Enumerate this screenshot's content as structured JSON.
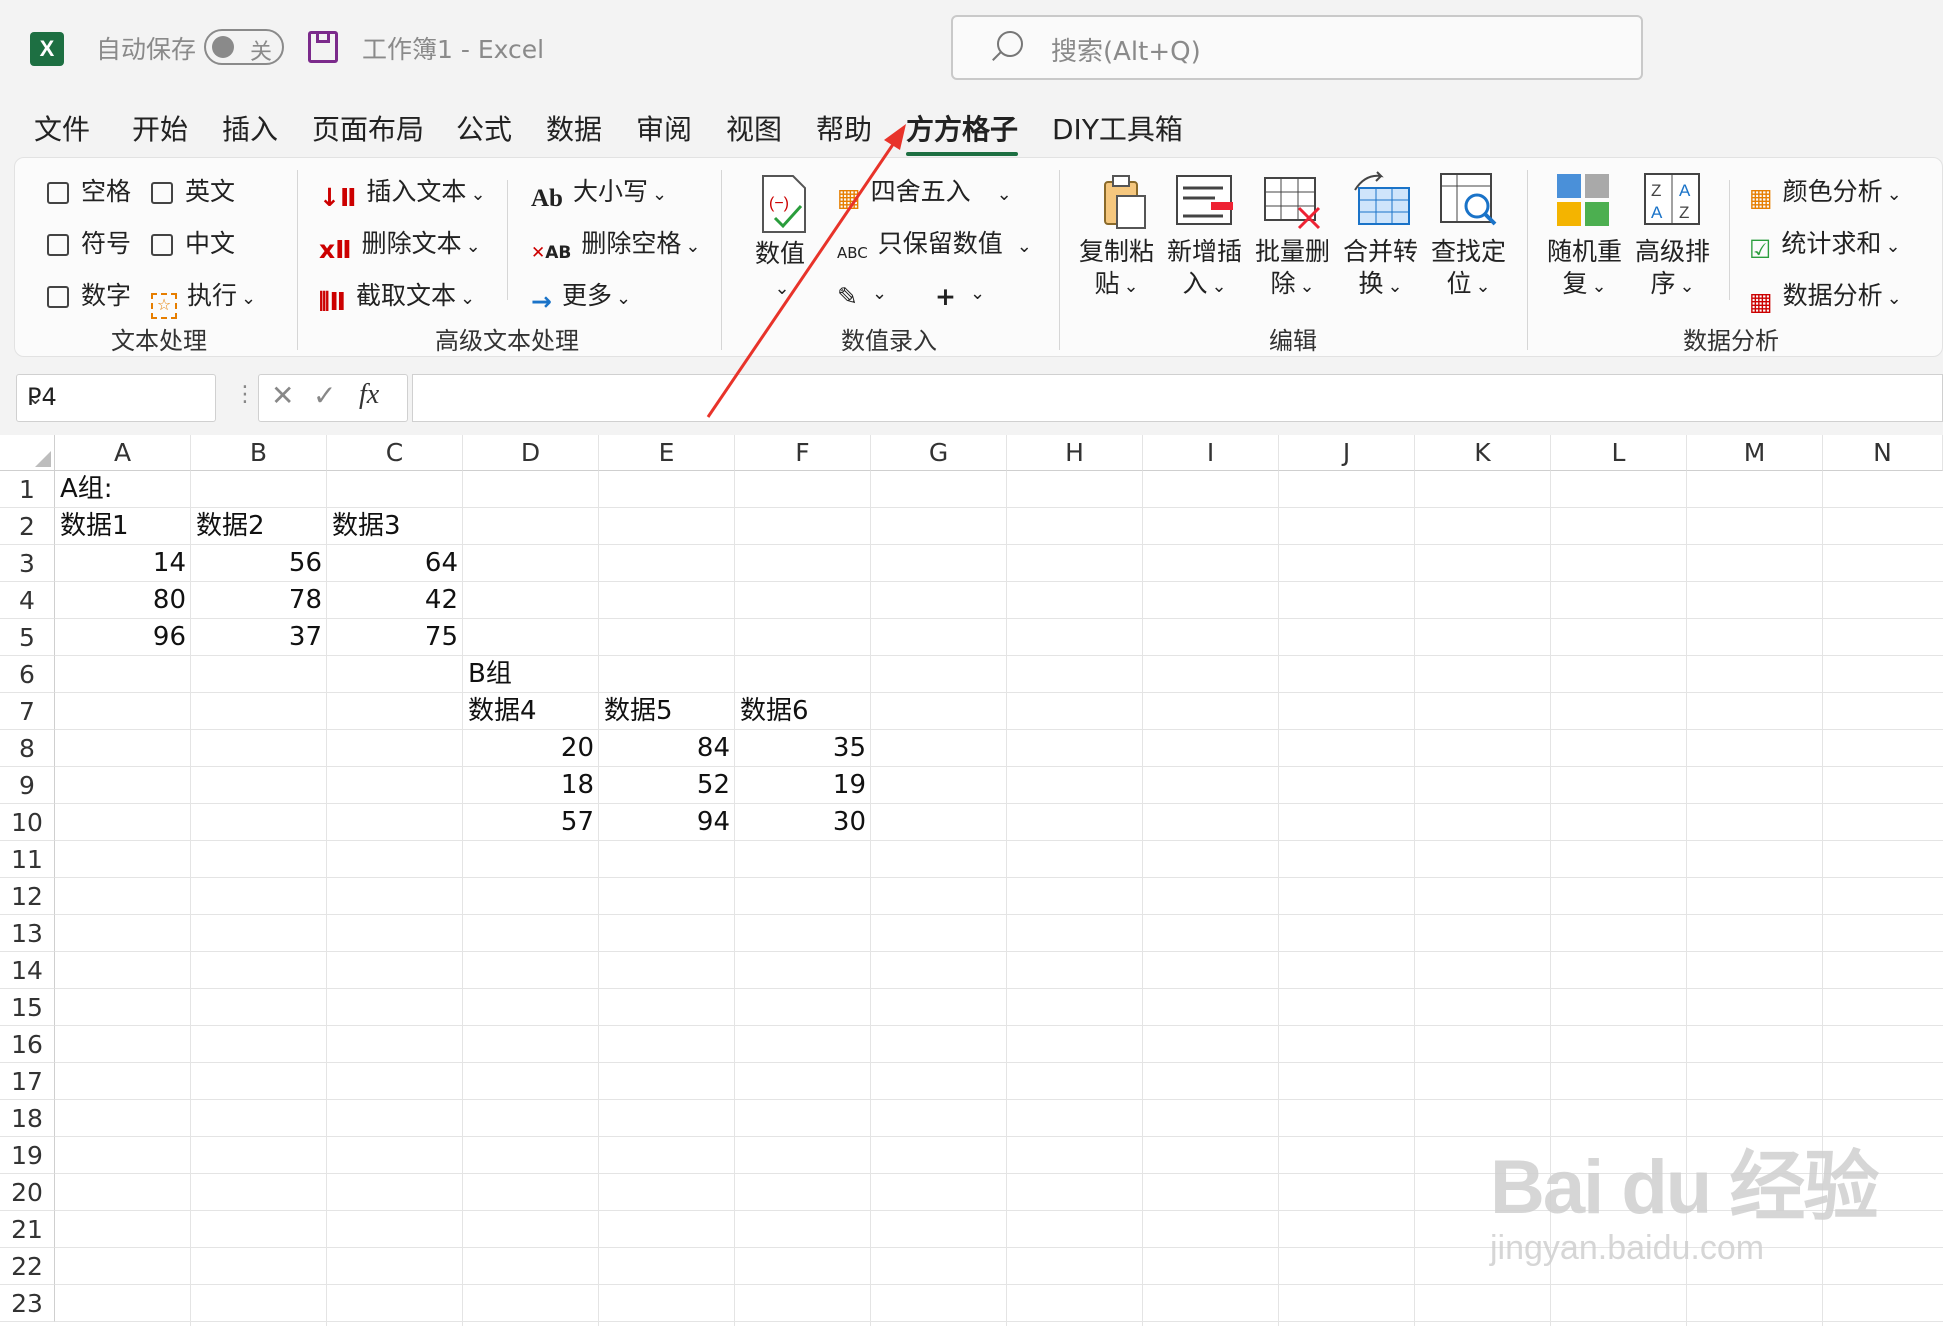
{
  "titlebar": {
    "app_icon_letter": "X",
    "autosave_label": "自动保存",
    "autosave_state": "关",
    "document_title": "工作簿1  -  Excel",
    "search_placeholder": "搜索(Alt+Q)"
  },
  "tabs": [
    "文件",
    "开始",
    "插入",
    "页面布局",
    "公式",
    "数据",
    "审阅",
    "视图",
    "帮助",
    "方方格子",
    "DIY工具箱"
  ],
  "active_tab": "方方格子",
  "ribbon": {
    "text_group": {
      "label": "文本处理",
      "checkboxes": [
        "空格",
        "英文",
        "符号",
        "中文",
        "数字"
      ],
      "execute": "执行"
    },
    "adv_text_group": {
      "label": "高级文本处理",
      "insert_text": "插入文本",
      "delete_text": "删除文本",
      "extract_text": "截取文本",
      "case": "大小写",
      "delete_spaces": "删除空格",
      "more": "更多"
    },
    "value_group": {
      "label": "数值录入",
      "value": "数值",
      "round": "四舍五入",
      "keep_values": "只保留数值",
      "abc": "ABC"
    },
    "edit_group": {
      "label": "编辑",
      "copy_paste": [
        "复制粘",
        "贴"
      ],
      "new_insert": [
        "新增插",
        "入"
      ],
      "batch_delete": [
        "批量删",
        "除"
      ],
      "merge_convert": [
        "合并转",
        "换"
      ],
      "find_locate": [
        "查找定",
        "位"
      ]
    },
    "analysis_group": {
      "label": "数据分析",
      "random_dup": [
        "随机重",
        "复"
      ],
      "adv_sort": [
        "高级排",
        "序"
      ],
      "color_analysis": "颜色分析",
      "stat_sum": "统计求和",
      "data_analysis": "数据分析"
    }
  },
  "formula_bar": {
    "name_box": "P4",
    "fx": "fx",
    "formula": ""
  },
  "sheet": {
    "columns": [
      "A",
      "B",
      "C",
      "D",
      "E",
      "F",
      "G",
      "H",
      "I",
      "J",
      "K",
      "L",
      "M",
      "N"
    ],
    "rows": [
      "1",
      "2",
      "3",
      "4",
      "5",
      "6",
      "7",
      "8",
      "9",
      "10",
      "11",
      "12",
      "13",
      "14",
      "15",
      "16",
      "17",
      "18",
      "19",
      "20",
      "21",
      "22",
      "23"
    ],
    "cells": {
      "A1": "A组:",
      "A2": "数据1",
      "B2": "数据2",
      "C2": "数据3",
      "A3": "14",
      "B3": "56",
      "C3": "64",
      "A4": "80",
      "B4": "78",
      "C4": "42",
      "A5": "96",
      "B5": "37",
      "C5": "75",
      "D6": "B组",
      "D7": "数据4",
      "E7": "数据5",
      "F7": "数据6",
      "D8": "20",
      "E8": "84",
      "F8": "35",
      "D9": "18",
      "E9": "52",
      "F9": "19",
      "D10": "57",
      "E10": "94",
      "F10": "30"
    }
  },
  "annotation_color": "#e8332a",
  "watermark": {
    "line1": "Bai du 经验",
    "line2": "jingyan.baidu.com"
  }
}
